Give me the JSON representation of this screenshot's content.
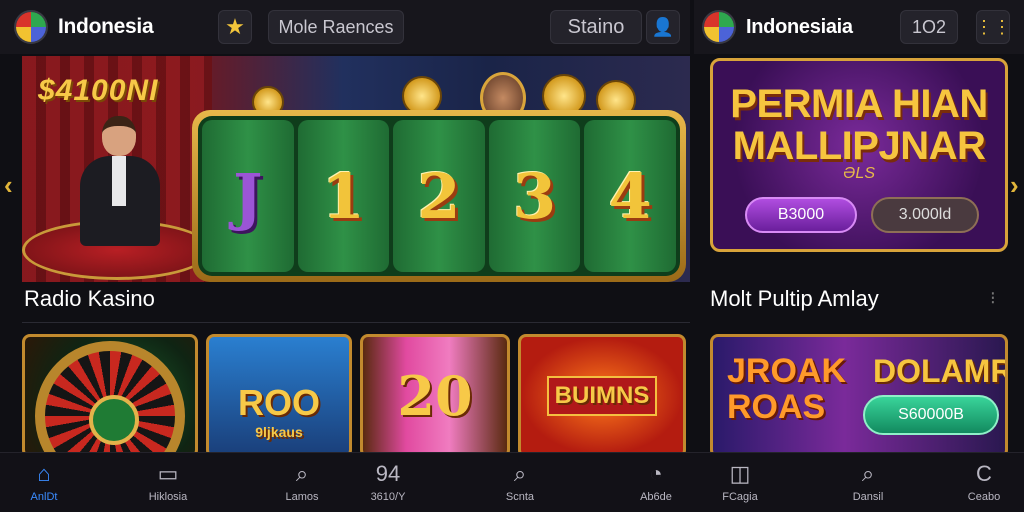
{
  "left_header": {
    "brand": "Indonesia",
    "search_label": "Mole Raences",
    "staino_label": "Staino",
    "star_icon": "★",
    "user_icon": "👤"
  },
  "right_header": {
    "brand": "Indonesiaia",
    "count_label": "1O2",
    "menu_icon": "⋮⋮"
  },
  "hero": {
    "title": "$4100NI",
    "reels": [
      "J",
      "1",
      "2",
      "3",
      "4"
    ]
  },
  "promo": {
    "title": "PERMIA HIAN MALLIPJNAR",
    "subtitle": "ƏLS",
    "button_primary": "B3000",
    "button_secondary": "3.000ld"
  },
  "sections": {
    "left_title": "Radio Kasino",
    "right_title": "Molt Pultip Amlay",
    "right_more": "⁝"
  },
  "tiles": {
    "t2_label": "ROO",
    "t2_sub": "9ljkaus",
    "t3_label": "20",
    "t4_label": "BUIMNS",
    "t5_left": "JROAK ROAS",
    "t5_right": "DOLAMR",
    "t5_pill": "S60000B"
  },
  "nav": [
    {
      "label": "AnlDt",
      "icon": "⌂"
    },
    {
      "label": "Hiklosia",
      "icon": "▭"
    },
    {
      "label": "Lamos",
      "icon": "⌕"
    },
    {
      "label": "3610/Y",
      "icon": "94"
    },
    {
      "label": "Scnta",
      "icon": "⌕"
    },
    {
      "label": "Ab6de",
      "icon": "◔"
    },
    {
      "label": "FCagia",
      "icon": "◫"
    },
    {
      "label": "Dansil",
      "icon": "⌕"
    },
    {
      "label": "Ceabo",
      "icon": "C"
    }
  ],
  "colors": {
    "accent_gold": "#f7c948",
    "nav_active": "#3b8cff",
    "background": "#0f0f14"
  }
}
